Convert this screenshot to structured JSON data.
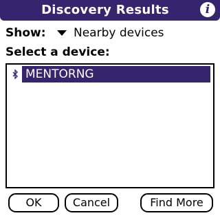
{
  "titlebar": {
    "title": "Discovery Results",
    "info_icon": "i"
  },
  "filter": {
    "label": "Show:",
    "selected": "Nearby devices"
  },
  "list": {
    "label": "Select a device:",
    "items": [
      {
        "name": "MENTORNG",
        "icon": "bluetooth-icon",
        "selected": true
      }
    ]
  },
  "buttons": {
    "ok": "OK",
    "cancel": "Cancel",
    "find_more": "Find More"
  },
  "colors": {
    "accent": "#36246f",
    "background": "#ffffff",
    "text": "#000000"
  }
}
